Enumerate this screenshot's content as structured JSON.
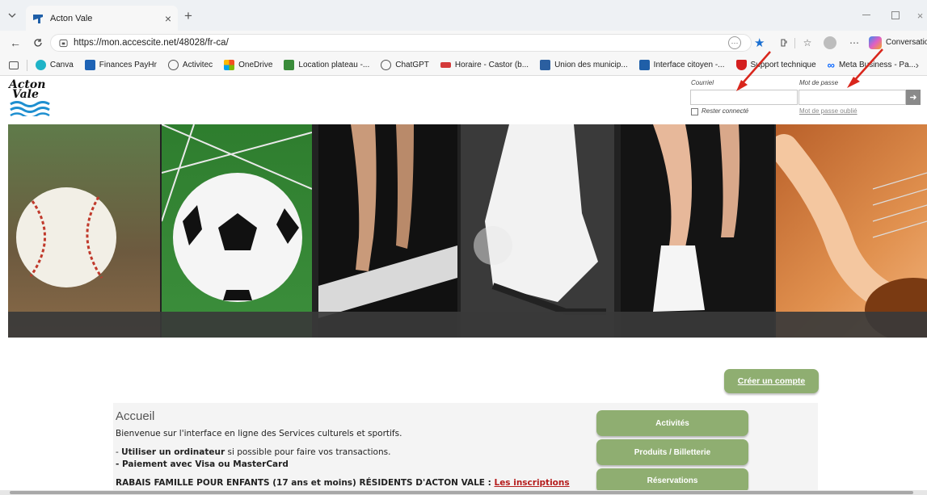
{
  "browser": {
    "tab_title": "Acton Vale",
    "new_tab": "+",
    "url": "https://mon.accescite.net/48028/fr-ca/",
    "conversation_label": "Conversation",
    "bookmarks": [
      {
        "label": "Canva",
        "icon": "canva-icon",
        "color": "#1fb3c7"
      },
      {
        "label": "Finances PayHr",
        "icon": "payhr-icon",
        "color": "#1e63b5"
      },
      {
        "label": "Activitec",
        "icon": "globe-icon",
        "color": "#555555"
      },
      {
        "label": "OneDrive",
        "icon": "onedrive-icon",
        "color": "#f2a71b"
      },
      {
        "label": "Location plateau -...",
        "icon": "location-icon",
        "color": "#3a8c3a"
      },
      {
        "label": "ChatGPT",
        "icon": "chatgpt-icon",
        "color": "#555555"
      },
      {
        "label": "Horaire - Castor (b...",
        "icon": "castor-icon",
        "color": "#d43a3a"
      },
      {
        "label": "Union des municip...",
        "icon": "umq-icon",
        "color": "#2b5fa0"
      },
      {
        "label": "Interface citoyen -...",
        "icon": "citoyen-icon",
        "color": "#1f5fa8"
      },
      {
        "label": "Support technique",
        "icon": "support-icon",
        "color": "#d41f1f"
      },
      {
        "label": "Meta Business - Pa...",
        "icon": "meta-icon",
        "color": "#0866ff"
      }
    ]
  },
  "site": {
    "logo_line1": "Acton",
    "logo_line2": "Vale",
    "email_label": "Courriel",
    "password_label": "Mot de passe",
    "remember_label": "Rester connecté",
    "forgot_label": "Mot de passe oublié",
    "login_arrow": "➜",
    "create_account": "Créer un compte",
    "welcome_title": "Accueil",
    "welcome_text": "Bienvenue sur l'interface en ligne des Services culturels et sportifs.",
    "bullet1_bold": "Utiliser un ordinateur",
    "bullet1_rest": " si possible pour faire vos transactions.",
    "bullet2": "- Paiement avec Visa ou MasterCard",
    "dash": "- ",
    "rabais_text": "RABAIS FAMILLE POUR ENFANTS (17 ans et moins) RÉSIDENTS D'ACTON VALE : ",
    "rabais_link": "Les inscriptions",
    "side_buttons": [
      "Activités",
      "Produits / Billetterie",
      "Réservations"
    ]
  },
  "colors": {
    "green_button": "#8fae71",
    "banner_bar": "#3a3a3a",
    "arrow_red": "#d9261c",
    "link_red": "#b51c1c",
    "logo_blue": "#1e8fd0"
  }
}
